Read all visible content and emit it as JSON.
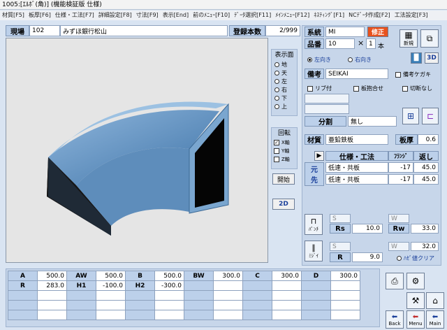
{
  "window": {
    "title": "1005:[ｴﾙﾎﾞ(角)]   (機能検証版 仕様)"
  },
  "menu": [
    "材質[F5]",
    "板厚[F6]",
    "仕様・工法[F7]",
    "詳細設定[F8]",
    "寸法[F9]",
    "表示[End]",
    "前のﾒﾆｭｰ[F10]",
    "ﾃﾞｰﾀ選択[F11]",
    "ﾒｲﾝﾒﾆｭｰ[F12]",
    "ﾈｽﾃｨﾝｸﾞ[F1]",
    "NCﾃﾞｰﾀ作成[F2]",
    "工法設定[F3]"
  ],
  "header": {
    "site_label": "現場",
    "site_code": "102",
    "site_name": "みずほ銀行松山",
    "count_label": "登録本数",
    "count_value": "2/999"
  },
  "view_panel": {
    "title": "表示面",
    "options": [
      "地",
      "天",
      "左",
      "右",
      "下",
      "上"
    ],
    "rotate_title": "回転",
    "rotate_options": [
      "X軸",
      "Y軸",
      "Z軸"
    ],
    "open_button": "開始",
    "mode_button": "2D"
  },
  "right": {
    "system_label": "系統",
    "system_value": "MI",
    "modify_button": "修正",
    "new_button": "新規",
    "part_label": "品番",
    "part_value": "10",
    "times": "×",
    "qty_value": "1",
    "qty_unit": "本",
    "orient_left": "左向き",
    "orient_right": "右向き",
    "orient_3d": "3D",
    "note_label": "備考",
    "note_value": "SEIKAI",
    "note_check": "備考ケガキ",
    "rib": "リブ付",
    "plate_merge": "板抱合せ",
    "no_cut": "切断なし",
    "split_label": "分割",
    "split_value": "無し",
    "material_label": "材質",
    "material_value": "亜鉛鉄板",
    "thickness_label": "板厚",
    "thickness_value": "0.6",
    "spec_header": "仕様・工法",
    "flange_header": "ﾌﾗﾝｼﾞ",
    "return_header": "返し",
    "row_origin": "元",
    "row_dest": "先",
    "rows": [
      {
        "spec": "低速・共板",
        "flange": "-17",
        "ret": "45.0"
      },
      {
        "spec": "低速・共板",
        "flange": "-17",
        "ret": "45.0"
      }
    ],
    "punch_label": "ﾊﾟﾝﾁ",
    "miji_label": "ﾐｼﾞｲ",
    "s_label": "S",
    "w_label": "W",
    "rs_label": "Rs",
    "rs_value": "10.0",
    "rw_label": "Rw",
    "rw_value": "33.0",
    "w2_value": "32.0",
    "r_label": "R",
    "r_value": "9.0",
    "clear_label": "ﾊｾﾞ値クリア"
  },
  "dims": {
    "row1": [
      {
        "k": "A",
        "v": "500.0"
      },
      {
        "k": "AW",
        "v": "500.0"
      },
      {
        "k": "B",
        "v": "500.0"
      },
      {
        "k": "BW",
        "v": "300.0"
      },
      {
        "k": "C",
        "v": "300.0"
      },
      {
        "k": "D",
        "v": "300.0"
      }
    ],
    "row2": [
      {
        "k": "R",
        "v": "283.0"
      },
      {
        "k": "H1",
        "v": "-100.0"
      },
      {
        "k": "H2",
        "v": "-300.0"
      }
    ]
  },
  "nav": {
    "back": "Back",
    "menu": "Menu",
    "main": "Main"
  },
  "colors": {
    "accent": "#e8521e",
    "panel": "#c7d6ea",
    "label": "#bcd0ea",
    "duct": "#5a8fc2"
  }
}
